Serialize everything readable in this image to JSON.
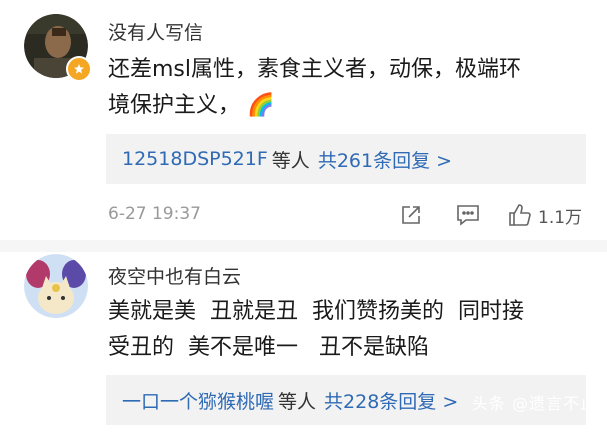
{
  "comments": [
    {
      "username": "没有人写信",
      "text_line1": "还差msl属性，素食主义者，动保，极端环",
      "text_line2": "境保护主义，",
      "text_emoji": "🌈",
      "reply_names": "12518DSP521F",
      "reply_mid": "等人",
      "reply_count": "共261条回复 >",
      "time": "6-27 19:37",
      "likes": "1.1万"
    },
    {
      "username": "夜空中也有白云",
      "text_line1": "美就是美  丑就是丑  我们赞扬美的  同时接",
      "text_line2": "受丑的  美不是唯一   丑不是缺陷",
      "reply_names": "一口一个猕猴桃喔",
      "reply_mid": "等人",
      "reply_count": "共228条回复 >"
    }
  ],
  "watermark": "头条 @遗言不止",
  "colors": {
    "link": "#2f6ab5",
    "reply_bg": "#f2f2f2",
    "badge": "#f5a623"
  }
}
